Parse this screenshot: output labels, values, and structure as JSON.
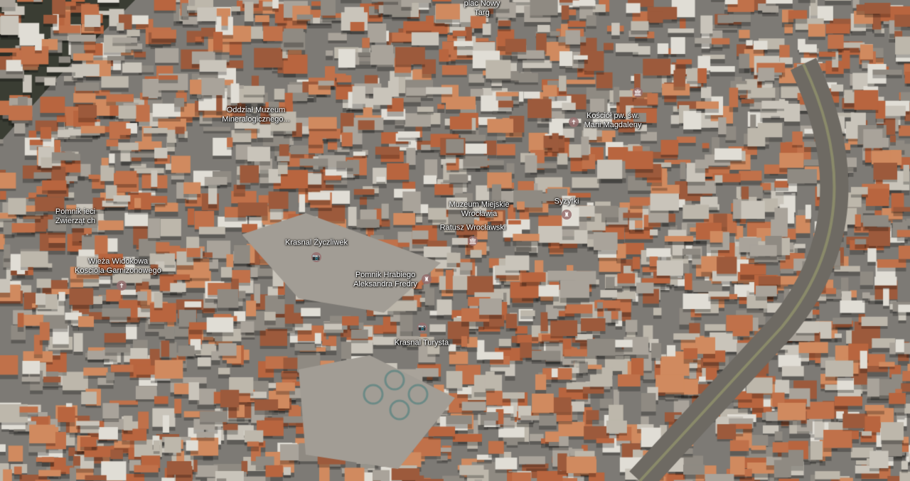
{
  "map": {
    "view": "3D satellite",
    "labels": [
      {
        "id": "plac-nowy-targ",
        "lines": [
          "plac Nowy",
          "Targ"
        ]
      },
      {
        "id": "muzeum-mineralogiczne",
        "lines": [
          "Oddział Muzeum",
          "Mineralogicznego..."
        ]
      },
      {
        "id": "kosciol-marii-magdaleny",
        "lines": [
          "Kościół pw. św.",
          "Marii Magdaleny"
        ]
      },
      {
        "id": "pomnik-zwierzat",
        "lines": [
          "Pomnik      ieci",
          "Zwierząt      ch"
        ]
      },
      {
        "id": "wieza-widokowa",
        "lines": [
          "Wieża Widokowa",
          "Kosciola Garnizonowego"
        ]
      },
      {
        "id": "muzeum-miejskie",
        "lines": [
          "Muzeum Miejskie",
          "Wrocławia"
        ]
      },
      {
        "id": "syzyfki",
        "lines": [
          "Syzyfki"
        ]
      },
      {
        "id": "ratusz",
        "lines": [
          "Ratusz Wrocławski"
        ]
      },
      {
        "id": "krasnal-zyczliwek",
        "lines": [
          "Krasnal Życzliwek"
        ]
      },
      {
        "id": "pomnik-fredry",
        "lines": [
          "Pomnik Hrabiego",
          "Aleksandra Fredry"
        ]
      },
      {
        "id": "krasnal-turysta",
        "lines": [
          "Krasnal Turysta"
        ]
      }
    ],
    "icons": {
      "camera": "📷",
      "museum": "🏛",
      "monument": "♜",
      "church": "✝"
    }
  }
}
